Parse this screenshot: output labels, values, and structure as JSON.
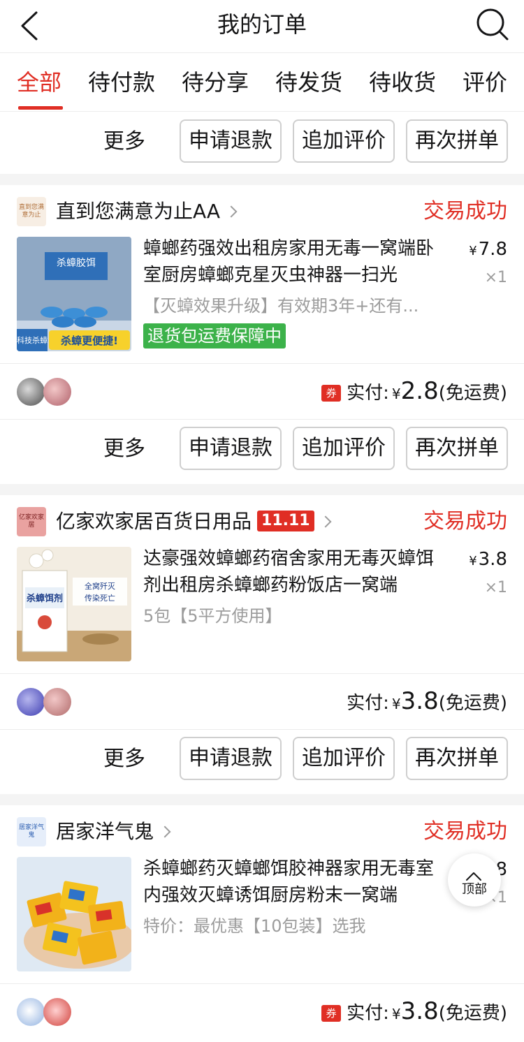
{
  "nav": {
    "title": "我的订单"
  },
  "tabs": [
    "全部",
    "待付款",
    "待分享",
    "待发货",
    "待收货",
    "评价"
  ],
  "actions": {
    "more": "更多",
    "refund": "申请退款",
    "add_review": "追加评价",
    "regroup": "再次拼单"
  },
  "orders": [
    {
      "shop_name": "直到您满意为止AA",
      "shop_logo_text": "直到您满意为止",
      "status": "交易成功",
      "title": "蟑螂药强效出租房家用无毒一窝端卧室厨房蟑螂克星灭虫神器一扫光",
      "spec": "【灭蟑效果升级】有效期3年+还有...",
      "guarantee": "退货包运费保障中",
      "currency": "¥",
      "unit_price": "7.8",
      "qty": "×1",
      "coupon": "券",
      "pay_label": "实付:",
      "pay_amount": "2.8",
      "shipping": "(免运费)",
      "image_text": {
        "top": "杀蟑胶饵",
        "bottom": "杀蟑更便捷!",
        "side": "科技杀蟑"
      }
    },
    {
      "shop_name": "亿家欢家居百货日用品",
      "shop_logo_text": "亿家欢家居",
      "badge": "11.11",
      "status": "交易成功",
      "title": "达豪强效蟑螂药宿舍家用无毒灭蟑饵剂出租房杀蟑螂药粉饭店一窝端",
      "spec": "5包【5平方使用】",
      "currency": "¥",
      "unit_price": "3.8",
      "qty": "×1",
      "pay_label": "实付:",
      "pay_amount": "3.8",
      "shipping": "(免运费)",
      "image_text": {
        "top": "杀蟑饵剂",
        "banner": "全窝歼灭 传染死亡"
      }
    },
    {
      "shop_name": "居家洋气鬼",
      "shop_logo_text": "居家洋气鬼",
      "status": "交易成功",
      "title": "杀蟑螂药灭蟑螂饵胶神器家用无毒室内强效灭蟑诱饵厨房粉末一窝端",
      "spec": "特价：最优惠【10包装】选我",
      "currency": "¥",
      "unit_price": "3.8",
      "qty": "×1",
      "coupon": "券",
      "pay_label": "实付:",
      "pay_amount": "3.8",
      "shipping": "(免运费)"
    }
  ],
  "back_to_top": "顶部",
  "colors": {
    "accent": "#e02e24",
    "guarantee": "#3cb24a",
    "muted": "#9c9c9c",
    "divider": "#f4f4f4"
  },
  "icons": {
    "back": "chevron-left-icon",
    "search": "search-icon",
    "top": "arrow-up-icon"
  }
}
